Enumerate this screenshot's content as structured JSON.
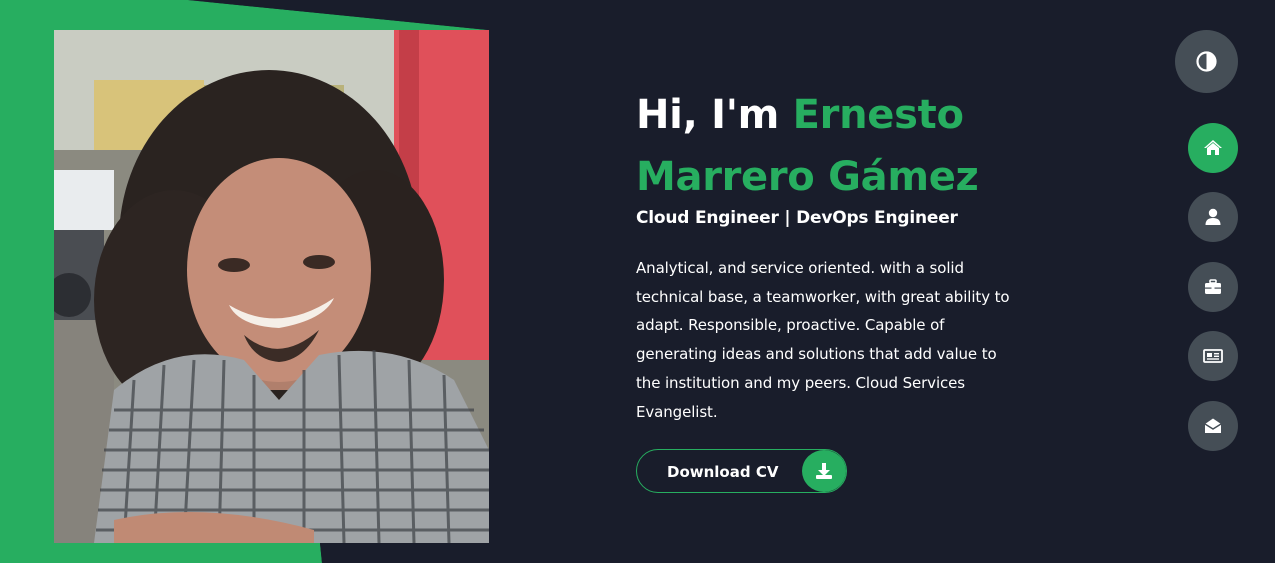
{
  "hero": {
    "title_greeting": "Hi, I'm ",
    "title_name": "Ernesto Marrero Gámez",
    "subtitle": "Cloud Engineer | DevOps Engineer",
    "description": "Analytical, and service oriented. with a solid technical base, a teamworker, with great ability to adapt. Responsible, proactive. Capable of generating ideas and solutions that add value to the institution and my peers. Cloud Services Evangelist."
  },
  "cv_button": {
    "label": "Download CV",
    "icon": "download-icon"
  },
  "theme_toggle": {
    "icon": "contrast-icon"
  },
  "nav": [
    {
      "id": "home",
      "icon": "home-icon",
      "active": true
    },
    {
      "id": "about",
      "icon": "user-icon",
      "active": false
    },
    {
      "id": "portfolio",
      "icon": "briefcase-icon",
      "active": false
    },
    {
      "id": "blogs",
      "icon": "newspaper-icon",
      "active": false
    },
    {
      "id": "contact",
      "icon": "envelope-open-icon",
      "active": false
    }
  ],
  "colors": {
    "background": "#191d2b",
    "accent": "#27ae60",
    "nav_button": "#454e56",
    "text": "#ffffff"
  }
}
